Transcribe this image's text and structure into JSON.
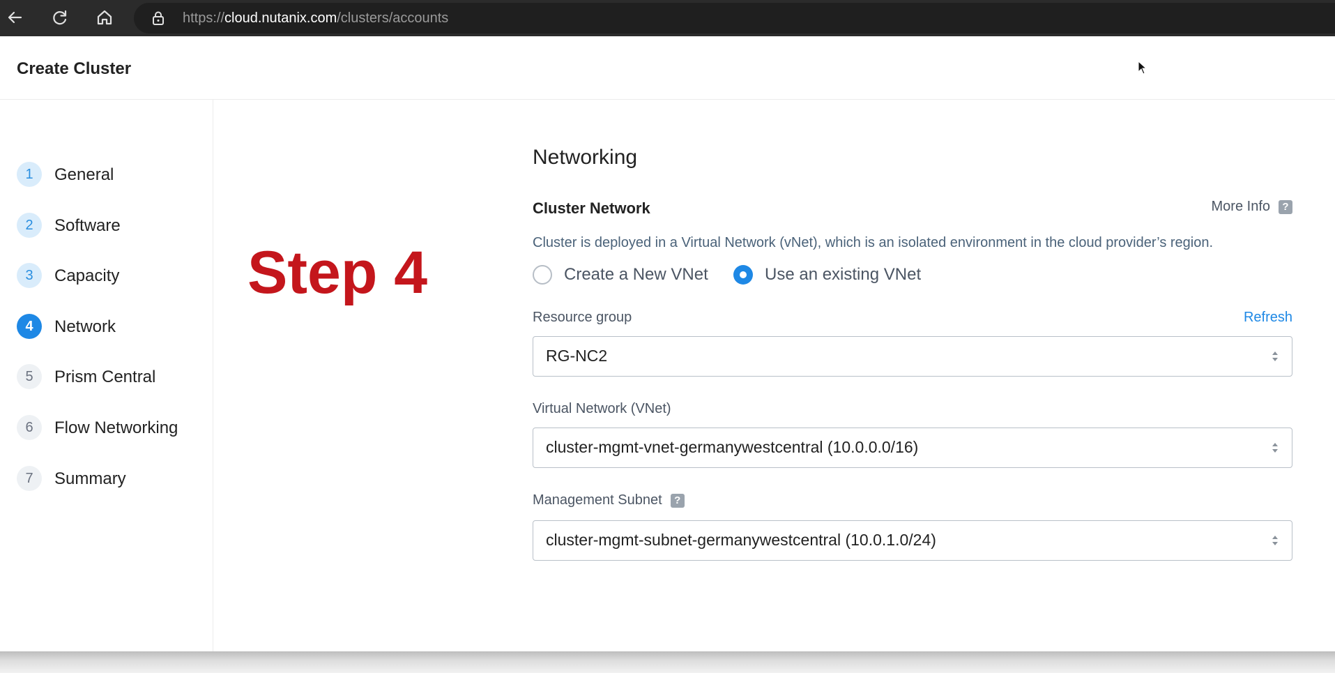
{
  "browser": {
    "url_scheme": "https://",
    "url_host": "cloud.nutanix.com",
    "url_path": "/clusters/accounts",
    "icons": [
      "back-arrow-icon",
      "reload-icon",
      "home-icon",
      "lock-icon"
    ]
  },
  "header": {
    "title": "Create Cluster"
  },
  "sidebar": {
    "steps": [
      {
        "number": "1",
        "label": "General",
        "state": "done"
      },
      {
        "number": "2",
        "label": "Software",
        "state": "done"
      },
      {
        "number": "3",
        "label": "Capacity",
        "state": "done"
      },
      {
        "number": "4",
        "label": "Network",
        "state": "active"
      },
      {
        "number": "5",
        "label": "Prism Central",
        "state": "todo"
      },
      {
        "number": "6",
        "label": "Flow Networking",
        "state": "todo"
      },
      {
        "number": "7",
        "label": "Summary",
        "state": "todo"
      }
    ]
  },
  "annotation": {
    "text": "Step 4",
    "color": "#c4161c"
  },
  "networking": {
    "title": "Networking",
    "cluster_network_title": "Cluster Network",
    "more_info": "More Info",
    "help_glyph": "?",
    "description": "Cluster is deployed in a Virtual Network (vNet), which is an isolated environment in the cloud provider’s region.",
    "radio_options": [
      {
        "label": "Create a New VNet",
        "checked": false
      },
      {
        "label": "Use an existing VNet",
        "checked": true
      }
    ],
    "resource_group": {
      "label": "Resource group",
      "refresh": "Refresh",
      "value": "RG-NC2"
    },
    "vnet": {
      "label": "Virtual Network (VNet)",
      "value": "cluster-mgmt-vnet-germanywestcentral (10.0.0.0/16)"
    },
    "subnet": {
      "label": "Management Subnet",
      "value": "cluster-mgmt-subnet-germanywestcentral (10.0.1.0/24)"
    }
  },
  "colors": {
    "accent": "#1e88e5",
    "browser_bar": "#2b2b2b"
  }
}
